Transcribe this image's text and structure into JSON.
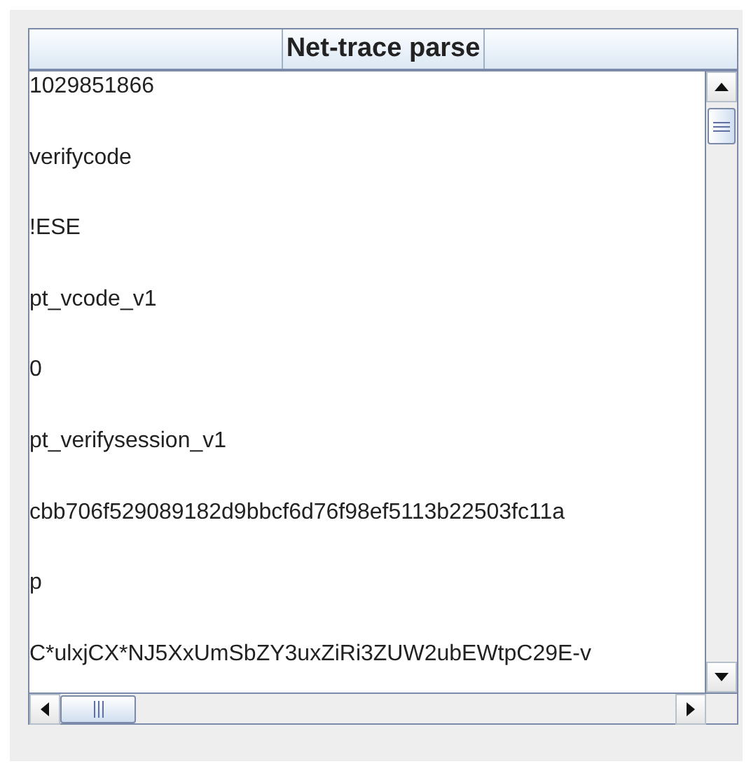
{
  "table": {
    "header": "Net-trace parse",
    "rows": [
      "1029851866",
      "verifycode",
      "!ESE",
      "pt_vcode_v1",
      "0",
      "pt_verifysession_v1",
      "cbb706f529089182d9bbcf6d76f98ef5113b22503fc11a",
      "p",
      "C*ulxjCX*NJ5XxUmSbZY3uxZiRi3ZUW2ubEWtpC29E-v"
    ]
  }
}
